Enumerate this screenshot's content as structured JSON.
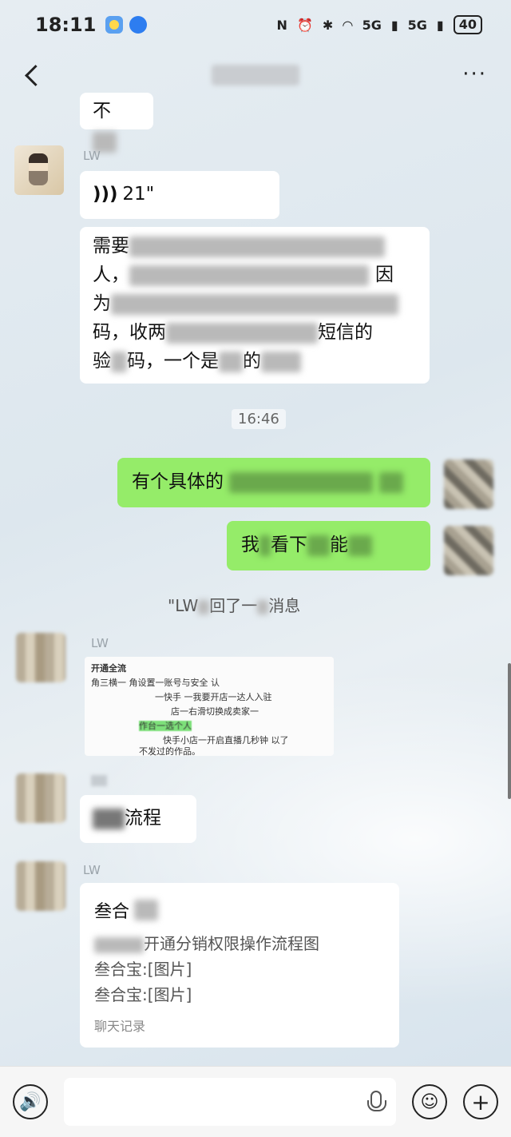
{
  "status_bar": {
    "time": "18:11",
    "network_1": "5G",
    "network_2": "5G",
    "battery": "40"
  },
  "header": {
    "more_label": "···"
  },
  "messages": {
    "top_partial": "不",
    "sender_1": "LW",
    "voice_duration": "21\"",
    "text_msg": {
      "line1_a": "需要",
      "line2_a": "人，",
      "line2_b": "因",
      "line3_a": "为",
      "line4_a": "码，收两",
      "line4_b": "短信的",
      "line5_a": "验",
      "line5_b": "码，",
      "line5_c": "一个是",
      "line5_d": "的"
    },
    "time_divider": "16:46",
    "mine_1": {
      "part1": "有个具体的"
    },
    "mine_2": {
      "part1": "我",
      "part2": "看下",
      "part3": "能"
    },
    "recall_note": {
      "part1": "\"LW",
      "part2": "回了一",
      "part3": "消息"
    },
    "sender_2": "LW",
    "image_lines": [
      "开通全流",
      "角三横一      角设置一账号与安全      认",
      "一快手      一我要开店一达人入驻",
      "店一右滑切换成卖家一",
      "作台一选个人",
      "快手小店一开启直播几秒钟      以了",
      "不发过的作品。"
    ],
    "flow_msg": {
      "part2": "流程"
    },
    "sender_4": "LW",
    "merged": {
      "title": "叁合",
      "line1": "开通分销权限操作流程图",
      "line2": "叁合宝:[图片]",
      "line3": "叁合宝:[图片]",
      "footer": "聊天记录"
    }
  },
  "input_bar": {
    "voice_label": "🔊",
    "emoji_label": "☺",
    "plus_label": "+"
  }
}
